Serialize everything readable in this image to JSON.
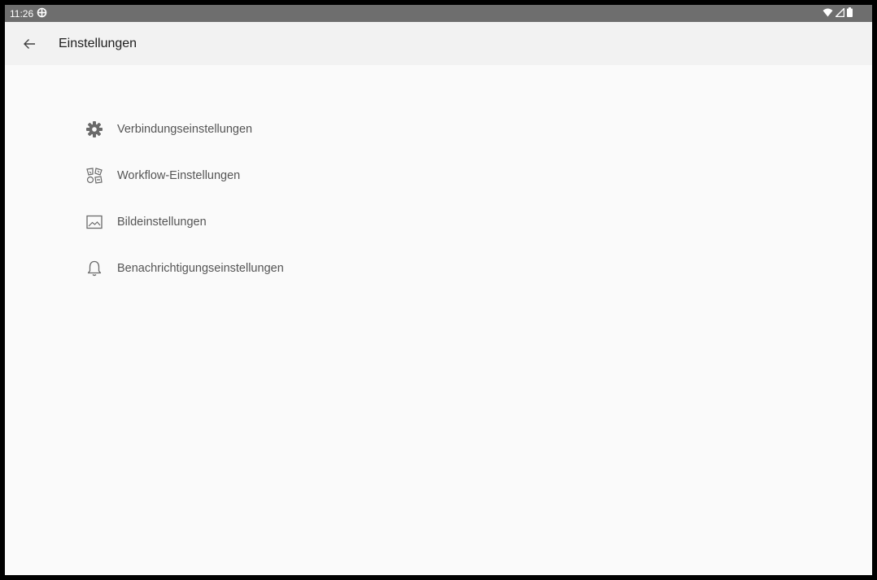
{
  "statusbar": {
    "time": "11:26"
  },
  "appbar": {
    "title": "Einstellungen"
  },
  "settings": {
    "items": [
      {
        "label": "Verbindungseinstellungen",
        "icon": "gear-icon"
      },
      {
        "label": "Workflow-Einstellungen",
        "icon": "workflow-icon"
      },
      {
        "label": "Bildeinstellungen",
        "icon": "image-icon"
      },
      {
        "label": "Benachrichtigungseinstellungen",
        "icon": "bell-icon"
      }
    ]
  },
  "colors": {
    "background": "#fafafa",
    "appbar": "#f2f2f2",
    "statusbar": "#6e6e6e",
    "icon": "#6a6a6a",
    "text": "#555555"
  }
}
